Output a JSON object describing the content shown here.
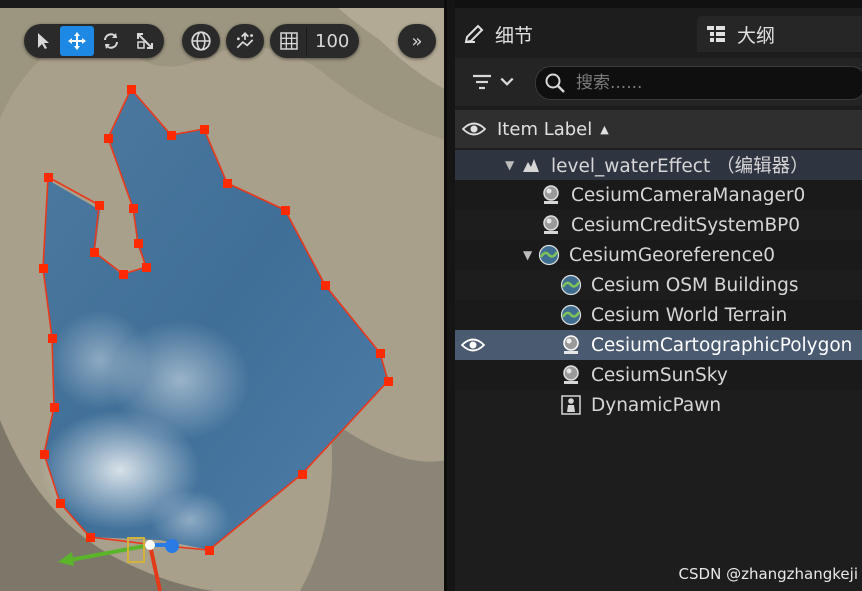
{
  "viewport": {
    "toolbar": {
      "select_tool": "select-tool",
      "move_tool": "move-tool",
      "rotate_tool": "rotate-tool",
      "scale_tool": "scale-tool",
      "world_local": "globe-icon",
      "surface_snap": "surface-snap-icon",
      "grid_snap_value": "100",
      "more": "»"
    }
  },
  "panel": {
    "tabs": [
      {
        "label": "细节",
        "icon": "pencil-icon"
      },
      {
        "label": "大纲",
        "icon": "outliner-icon"
      }
    ],
    "search": {
      "placeholder": "搜索......"
    },
    "header": {
      "label": "Item Label",
      "sort_indicator": "▲"
    },
    "tree": [
      {
        "label": "level_waterEffect （编辑器）",
        "type": "world",
        "indent": 1,
        "expanded": true
      },
      {
        "label": "CesiumCameraManager0",
        "type": "actor",
        "indent": 2
      },
      {
        "label": "CesiumCreditSystemBP0",
        "type": "actor",
        "indent": 2
      },
      {
        "label": "CesiumGeoreference0",
        "type": "georef",
        "indent": 2,
        "expanded": true
      },
      {
        "label": "Cesium OSM Buildings",
        "type": "tileset",
        "indent": 3
      },
      {
        "label": "Cesium World Terrain",
        "type": "tileset",
        "indent": 3
      },
      {
        "label": "CesiumCartographicPolygon",
        "type": "actor",
        "indent": 3,
        "selected": true
      },
      {
        "label": "CesiumSunSky",
        "type": "actor",
        "indent": 3
      },
      {
        "label": "DynamicPawn",
        "type": "pawn",
        "indent": 3
      }
    ]
  },
  "watermark": "CSDN @zhangzhangkeji",
  "colors": {
    "accent": "#1e88e5",
    "selection": "#4a5a70",
    "polygon": "#ff2a00"
  }
}
